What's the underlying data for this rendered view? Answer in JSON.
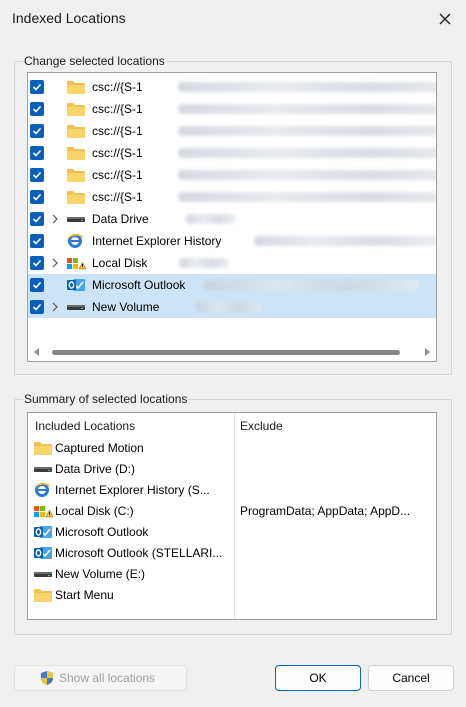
{
  "window": {
    "title": "Indexed Locations"
  },
  "change_group": {
    "legend": "Change selected locations",
    "rows": [
      {
        "label": "csc://{S-1",
        "icon": "folder-icon",
        "expandable": false,
        "selected": false
      },
      {
        "label": "csc://{S-1",
        "icon": "folder-icon",
        "expandable": false,
        "selected": false
      },
      {
        "label": "csc://{S-1",
        "icon": "folder-icon",
        "expandable": false,
        "selected": false
      },
      {
        "label": "csc://{S-1",
        "icon": "folder-icon",
        "expandable": false,
        "selected": false
      },
      {
        "label": "csc://{S-1",
        "icon": "folder-icon",
        "expandable": false,
        "selected": false
      },
      {
        "label": "csc://{S-1",
        "icon": "folder-icon",
        "expandable": false,
        "selected": false
      },
      {
        "label": "Data Drive",
        "icon": "drive-icon",
        "expandable": true,
        "selected": false
      },
      {
        "label": "Internet Explorer History",
        "icon": "ie-history-icon",
        "expandable": false,
        "selected": false
      },
      {
        "label": "Local Disk",
        "icon": "local-disk-icon",
        "expandable": true,
        "selected": false
      },
      {
        "label": "Microsoft Outlook",
        "icon": "outlook-icon",
        "expandable": false,
        "selected": true
      },
      {
        "label": "New Volume",
        "icon": "drive-icon",
        "expandable": true,
        "selected": true
      }
    ]
  },
  "summary_group": {
    "legend": "Summary of selected locations",
    "col_included": "Included Locations",
    "col_exclude": "Exclude",
    "rows": [
      {
        "label": "Captured Motion",
        "icon": "folder-icon",
        "exclude": ""
      },
      {
        "label": "Data Drive (D:)",
        "icon": "drive-icon",
        "exclude": ""
      },
      {
        "label": "Internet Explorer History (S...",
        "icon": "ie-history-icon",
        "exclude": ""
      },
      {
        "label": "Local Disk (C:)",
        "icon": "local-disk-icon",
        "exclude": "ProgramData; AppData; AppD..."
      },
      {
        "label": "Microsoft Outlook",
        "icon": "outlook-icon",
        "exclude": ""
      },
      {
        "label": "Microsoft Outlook (STELLARI...",
        "icon": "outlook-icon",
        "exclude": ""
      },
      {
        "label": "New Volume (E:)",
        "icon": "drive-icon",
        "exclude": ""
      },
      {
        "label": "Start Menu",
        "icon": "folder-icon",
        "exclude": ""
      }
    ]
  },
  "buttons": {
    "show_all": "Show all locations",
    "ok": "OK",
    "cancel": "Cancel"
  },
  "colors": {
    "accent": "#0b5fba",
    "selection": "#cce4f7",
    "folder": "#f2c24f"
  }
}
